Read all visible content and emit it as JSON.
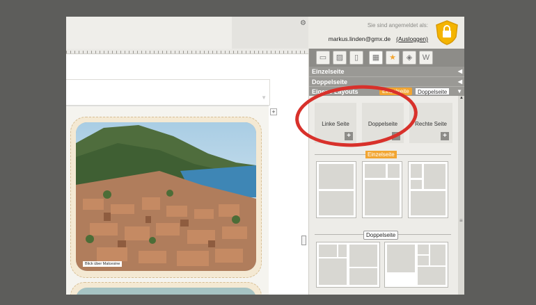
{
  "login": {
    "label": "Sie sind angemeldet als:",
    "user": "markus.linden@gmx.de",
    "logout": "(Ausloggen)"
  },
  "panel": {
    "accordion": [
      {
        "label": "Einzelseite"
      },
      {
        "label": "Doppelseite"
      },
      {
        "label": "Eigene Layouts",
        "badge_single": "Einzelseite",
        "badge_double": "Doppelseite"
      }
    ],
    "tiles": [
      {
        "label": "Linke Seite"
      },
      {
        "label": "Doppelseite"
      },
      {
        "label": "Rechte Seite"
      }
    ],
    "section_single": "Einzelseite",
    "section_double": "Doppelseite",
    "tab_w": "W"
  },
  "photo": {
    "caption": "Blick über Malcesine"
  },
  "colors": {
    "accent": "#f2a531",
    "highlight_circle": "#d8312b",
    "panel_bar": "#9a9995"
  }
}
